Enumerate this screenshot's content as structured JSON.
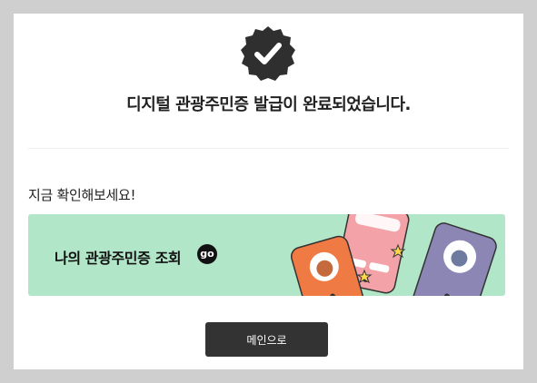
{
  "completion": {
    "badge_icon": "verified-check-icon",
    "title": "디지털 관광주민증 발급이 완료되었습니다."
  },
  "check": {
    "label": "지금 확인해보세요!"
  },
  "banner": {
    "text": "나의 관광주민증 조회",
    "go_label": "go",
    "background_color": "#b2e6c8"
  },
  "main_button": {
    "label": "메인으로",
    "color": "#333333"
  }
}
